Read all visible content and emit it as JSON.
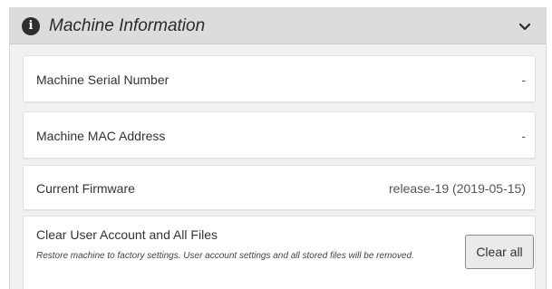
{
  "panel": {
    "title": "Machine Information",
    "info_icon_glyph": "i",
    "icons": {
      "info": "info-circle-icon",
      "toggle": "chevron-down-icon"
    }
  },
  "rows": [
    {
      "label": "Machine Serial Number",
      "value": "-"
    },
    {
      "label": "Machine MAC Address",
      "value": "-"
    },
    {
      "label": "Current Firmware",
      "value": "release-19 (2019-05-15)"
    }
  ],
  "clear_section": {
    "title": "Clear User Account and All Files",
    "description": "Restore machine to factory settings. User account settings and all stored files will be removed.",
    "button_label": "Clear all"
  },
  "colors": {
    "header_bg": "#dcdcdc",
    "panel_bg": "#f1f1f1",
    "card_bg": "#ffffff",
    "icon": "#2e2e2e"
  }
}
